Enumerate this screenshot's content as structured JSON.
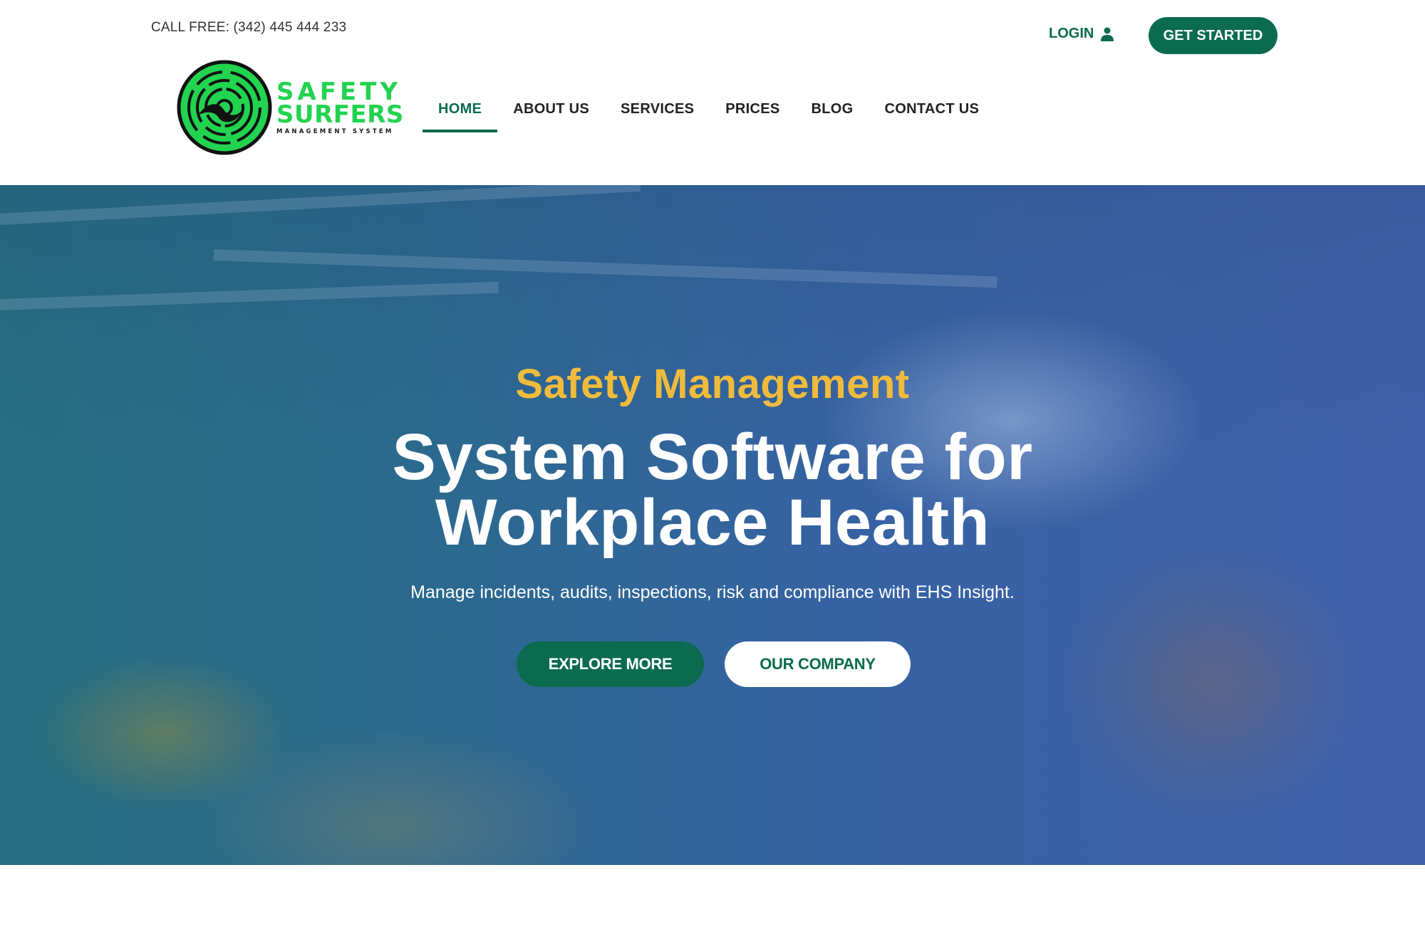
{
  "topbar": {
    "call_free": "CALL FREE: (342) 445 444 233",
    "login_label": "LOGIN",
    "login_icon": "user-icon",
    "get_started_label": "GET STARTED"
  },
  "logo": {
    "line1": "SAFETY",
    "line2": "SURFERS",
    "line3": "MANAGEMENT SYSTEM",
    "icon": "wave-circle-logo"
  },
  "nav": {
    "items": [
      {
        "label": "HOME",
        "active": true
      },
      {
        "label": "ABOUT US",
        "active": false
      },
      {
        "label": "SERVICES",
        "active": false
      },
      {
        "label": "PRICES",
        "active": false
      },
      {
        "label": "BLOG",
        "active": false
      },
      {
        "label": "CONTACT US",
        "active": false
      }
    ]
  },
  "hero": {
    "subtitle": "Safety Management",
    "title_line1": "System Software for",
    "title_line2": "Workplace Health",
    "description": "Manage incidents, audits, inspections, risk and compliance with EHS Insight.",
    "explore_label": "EXPLORE MORE",
    "company_label": "OUR COMPANY"
  },
  "colors": {
    "brand_green": "#0b6b4f",
    "logo_green": "#22d34f",
    "accent_yellow": "#f0bb3c"
  }
}
